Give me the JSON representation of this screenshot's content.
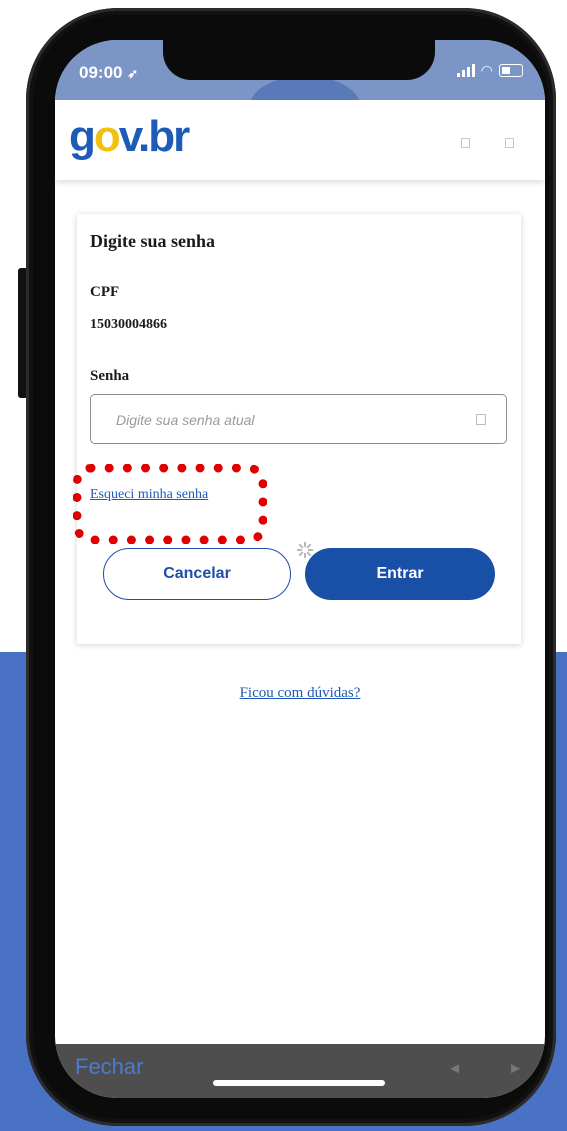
{
  "status": {
    "time": "09:00"
  },
  "header": {
    "logo_g": "g",
    "logo_o": "o",
    "logo_v": "v",
    "logo_dot": ".",
    "logo_br": "br"
  },
  "form": {
    "title": "Digite sua senha",
    "cpf_label": "CPF",
    "cpf_value": "15030004866",
    "password_label": "Senha",
    "password_placeholder": "Digite sua senha atual",
    "forgot_link": "Esqueci minha senha",
    "cancel_label": "Cancelar",
    "enter_label": "Entrar"
  },
  "help_link": "Ficou com dúvidas?",
  "bottom": {
    "close_label": "Fechar",
    "back_arrow": "◄",
    "forward_arrow": "►"
  },
  "colors": {
    "primary": "#1850a8",
    "link": "#1e5bb7",
    "logo_yellow": "#f2c010",
    "highlight": "#e00000",
    "page_bg_blue": "#4a72c4"
  }
}
